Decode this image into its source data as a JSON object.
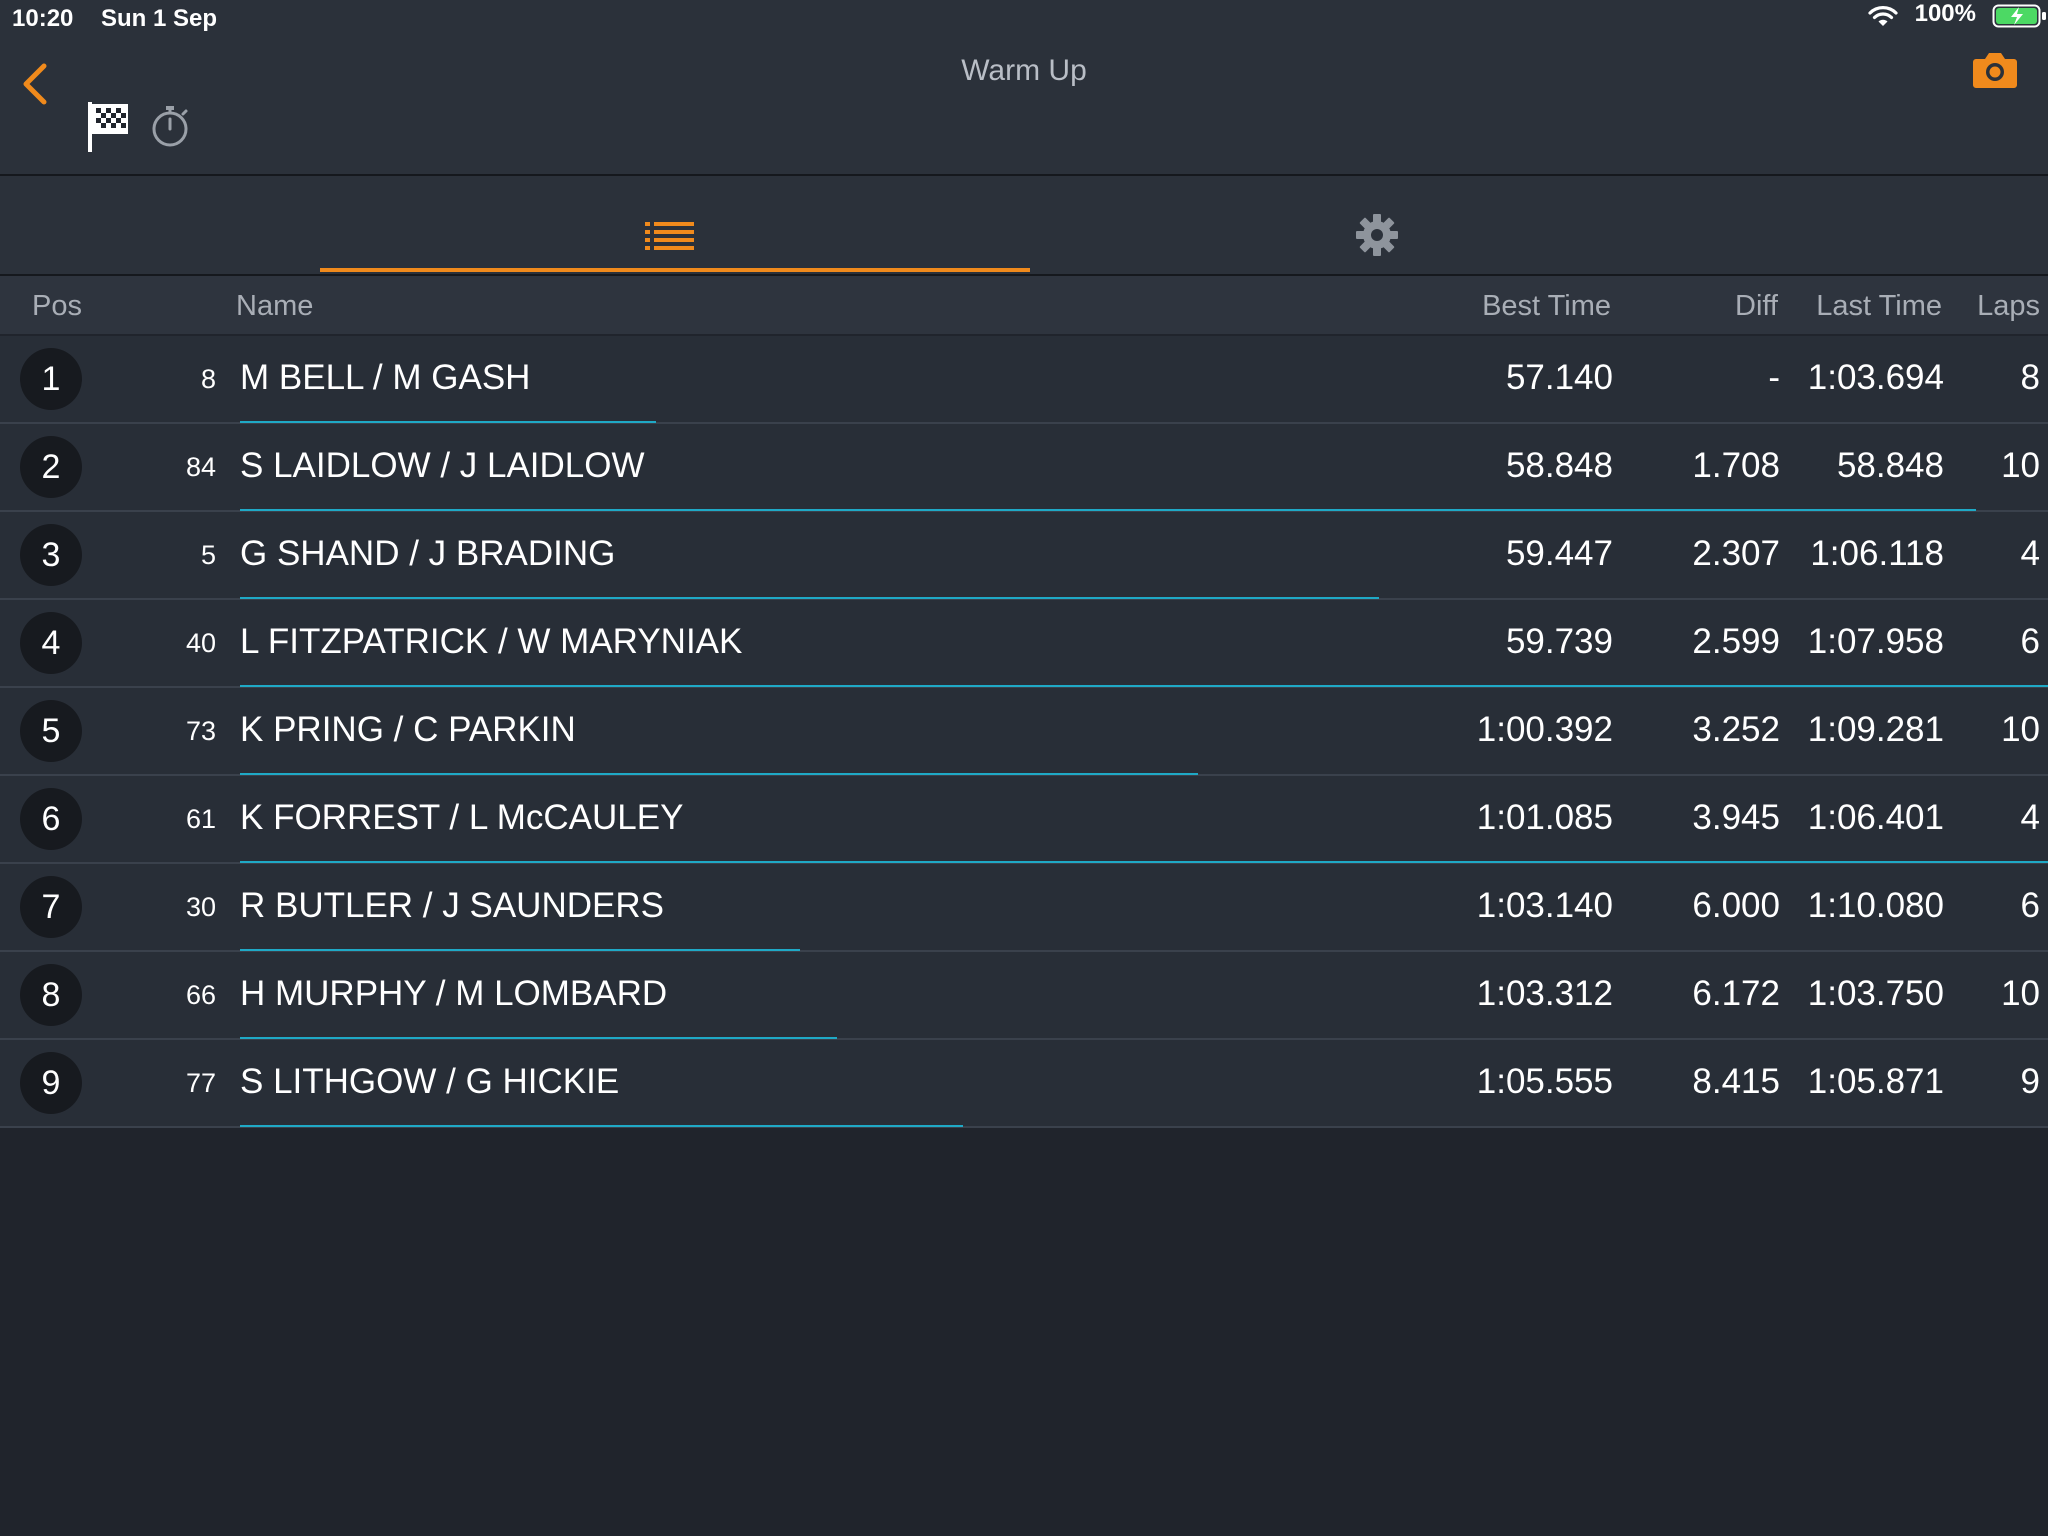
{
  "status_bar": {
    "time": "10:20",
    "date": "Sun 1 Sep",
    "battery_percent": "100%",
    "battery_charging": true,
    "wifi": true
  },
  "header": {
    "title": "Warm Up",
    "back_icon": "chevron-left-icon",
    "flag_icon": "checkered-flag-icon",
    "stopwatch_icon": "stopwatch-icon",
    "camera_icon": "camera-icon"
  },
  "tabs": [
    {
      "icon": "list-icon",
      "active": true
    },
    {
      "icon": "gear-icon",
      "active": false
    }
  ],
  "table": {
    "columns": {
      "pos": "Pos",
      "name": "Name",
      "best_time": "Best Time",
      "diff": "Diff",
      "last_time": "Last Time",
      "laps": "Laps"
    },
    "rows": [
      {
        "pos": "1",
        "car": "8",
        "name": "M BELL / M GASH",
        "best": "57.140",
        "diff": "-",
        "last": "1:03.694",
        "laps": "8",
        "progress": 0.23
      },
      {
        "pos": "2",
        "car": "84",
        "name": "S LAIDLOW / J LAIDLOW",
        "best": "58.848",
        "diff": "1.708",
        "last": "58.848",
        "laps": "10",
        "progress": 0.96
      },
      {
        "pos": "3",
        "car": "5",
        "name": "G SHAND / J BRADING",
        "best": "59.447",
        "diff": "2.307",
        "last": "1:06.118",
        "laps": "4",
        "progress": 0.63
      },
      {
        "pos": "4",
        "car": "40",
        "name": "L FITZPATRICK / W MARYNIAK",
        "best": "59.739",
        "diff": "2.599",
        "last": "1:07.958",
        "laps": "6",
        "progress": 1.0
      },
      {
        "pos": "5",
        "car": "73",
        "name": "K PRING / C PARKIN",
        "best": "1:00.392",
        "diff": "3.252",
        "last": "1:09.281",
        "laps": "10",
        "progress": 0.53
      },
      {
        "pos": "6",
        "car": "61",
        "name": "K FORREST / L McCAULEY",
        "best": "1:01.085",
        "diff": "3.945",
        "last": "1:06.401",
        "laps": "4",
        "progress": 1.0
      },
      {
        "pos": "7",
        "car": "30",
        "name": "R BUTLER / J SAUNDERS",
        "best": "1:03.140",
        "diff": "6.000",
        "last": "1:10.080",
        "laps": "6",
        "progress": 0.31
      },
      {
        "pos": "8",
        "car": "66",
        "name": "H MURPHY / M LOMBARD",
        "best": "1:03.312",
        "diff": "6.172",
        "last": "1:03.750",
        "laps": "10",
        "progress": 0.33
      },
      {
        "pos": "9",
        "car": "77",
        "name": "S LITHGOW / G HICKIE",
        "best": "1:05.555",
        "diff": "8.415",
        "last": "1:05.871",
        "laps": "9",
        "progress": 0.4
      }
    ]
  },
  "colors": {
    "accent": "#f08a1c",
    "progress": "#1fa9c6",
    "background": "#20242c",
    "panel": "#2b313a"
  }
}
